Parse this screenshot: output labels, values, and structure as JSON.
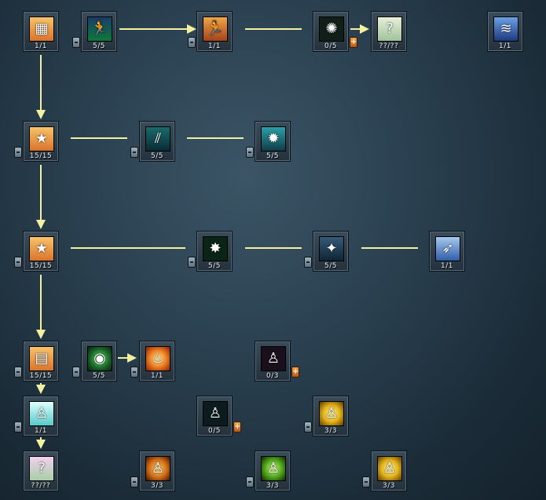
{
  "skills": [
    {
      "id": "s1",
      "level": "1/1",
      "icon": "treasure-box-icon",
      "theme": "t-box",
      "glyph": "▦",
      "minus": false,
      "plus": false
    },
    {
      "id": "s2",
      "level": "5/5",
      "icon": "figure-leaves-icon",
      "theme": "t-green",
      "glyph": "🏃",
      "minus": true,
      "plus": false
    },
    {
      "id": "s3",
      "level": "1/1",
      "icon": "figure-leaves-orange-icon",
      "theme": "t-orange",
      "glyph": "🏃",
      "minus": true,
      "plus": false
    },
    {
      "id": "s4",
      "level": "0/5",
      "icon": "dark-creature-icon",
      "theme": "t-dark",
      "glyph": "✺",
      "minus": false,
      "plus": true
    },
    {
      "id": "s5",
      "level": "??/??",
      "icon": "question-mark-icon",
      "theme": "t-quest",
      "glyph": "?",
      "minus": false,
      "plus": false
    },
    {
      "id": "s6",
      "level": "1/1",
      "icon": "dash-figure-icon",
      "theme": "t-blue",
      "glyph": "≋",
      "minus": false,
      "plus": false
    },
    {
      "id": "s7",
      "level": "15/15",
      "icon": "treasure-box-stars-icon",
      "theme": "t-box",
      "glyph": "★",
      "minus": true,
      "plus": false
    },
    {
      "id": "s8",
      "level": "5/5",
      "icon": "claw-slash-icon",
      "theme": "t-teal",
      "glyph": "⫽",
      "minus": true,
      "plus": false
    },
    {
      "id": "s9",
      "level": "5/5",
      "icon": "thorn-burst-icon",
      "theme": "t-cyan",
      "glyph": "✹",
      "minus": true,
      "plus": false
    },
    {
      "id": "s10",
      "level": "15/15",
      "icon": "treasure-box-stars-icon",
      "theme": "t-box",
      "glyph": "★",
      "minus": true,
      "plus": false
    },
    {
      "id": "s11",
      "level": "5/5",
      "icon": "green-beast-icon",
      "theme": "t-green2",
      "glyph": "✸",
      "minus": true,
      "plus": false
    },
    {
      "id": "s12",
      "level": "5/5",
      "icon": "shadow-leap-icon",
      "theme": "t-steel",
      "glyph": "✦",
      "minus": true,
      "plus": false
    },
    {
      "id": "s13",
      "level": "1/1",
      "icon": "swift-runner-icon",
      "theme": "t-sky",
      "glyph": "➶",
      "minus": false,
      "plus": false
    },
    {
      "id": "s14",
      "level": "15/15",
      "icon": "treasure-box-max-icon",
      "theme": "t-box",
      "glyph": "▤",
      "minus": true,
      "plus": false
    },
    {
      "id": "s15",
      "level": "5/5",
      "icon": "green-ring-icon",
      "theme": "t-ring",
      "glyph": "◉",
      "minus": true,
      "plus": false
    },
    {
      "id": "s16",
      "level": "1/1",
      "icon": "fire-figure-icon",
      "theme": "t-fire",
      "glyph": "♨",
      "minus": true,
      "plus": false
    },
    {
      "id": "s17",
      "level": "0/3",
      "icon": "purple-figure-icon",
      "theme": "t-purple",
      "glyph": "♙",
      "minus": false,
      "plus": true
    },
    {
      "id": "s18",
      "level": "1/1",
      "icon": "aqua-figure-icon",
      "theme": "t-aqua",
      "glyph": "♙",
      "minus": true,
      "plus": false
    },
    {
      "id": "s19",
      "level": "0/5",
      "icon": "dark-teal-figure-icon",
      "theme": "t-darkteal",
      "glyph": "♙",
      "minus": false,
      "plus": true
    },
    {
      "id": "s20",
      "level": "3/3",
      "icon": "golden-aura-icon",
      "theme": "t-gold",
      "glyph": "♙",
      "minus": true,
      "plus": false
    },
    {
      "id": "s21",
      "level": "??/??",
      "icon": "question-mark-pink-icon",
      "theme": "t-quest2",
      "glyph": "?",
      "minus": false,
      "plus": false
    },
    {
      "id": "s22",
      "level": "3/3",
      "icon": "orange-aura-icon",
      "theme": "t-orb-o",
      "glyph": "♙",
      "minus": true,
      "plus": false
    },
    {
      "id": "s23",
      "level": "3/3",
      "icon": "green-aura-icon",
      "theme": "t-orb-g",
      "glyph": "♙",
      "minus": true,
      "plus": false
    },
    {
      "id": "s24",
      "level": "3/3",
      "icon": "gold-aura-icon",
      "theme": "t-gold",
      "glyph": "♙",
      "minus": true,
      "plus": false
    }
  ],
  "colors": {
    "connector": "#f3f0a0",
    "background": "#2a4050"
  }
}
